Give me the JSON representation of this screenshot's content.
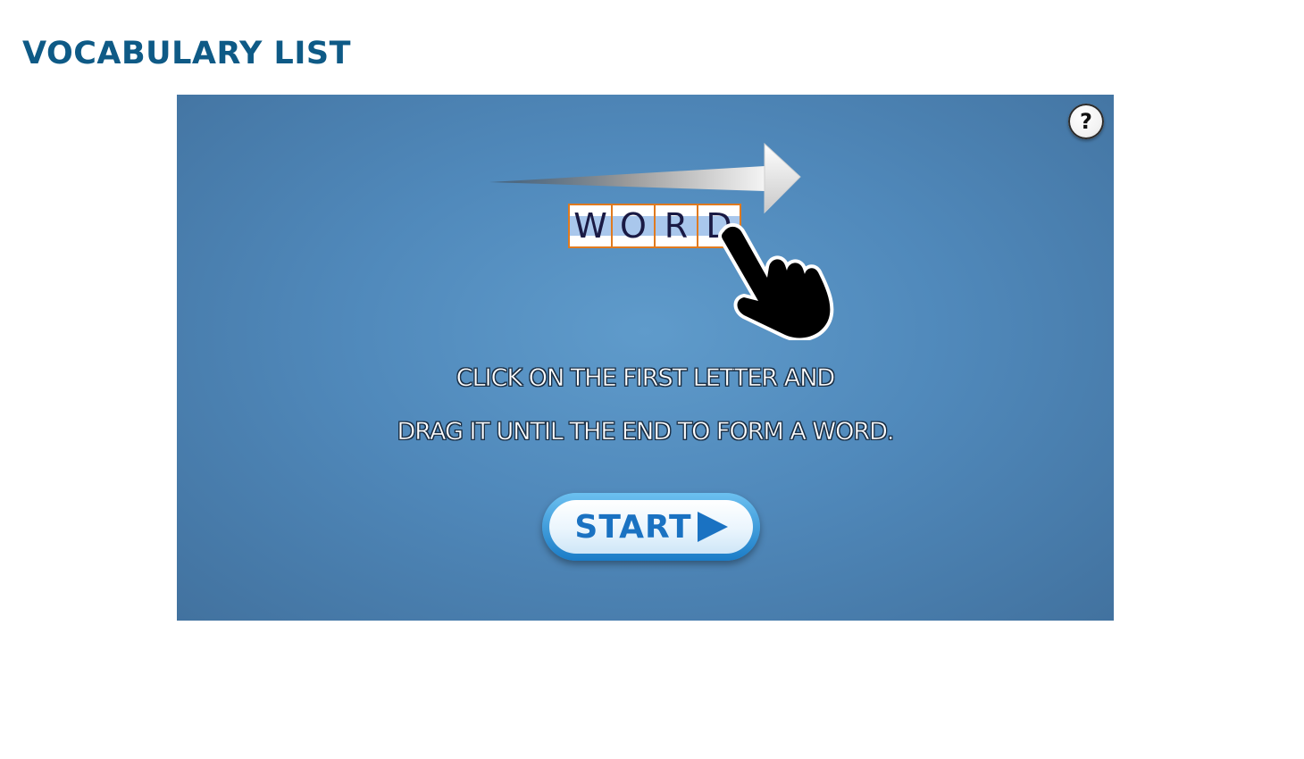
{
  "header": {
    "title": "VOCABULARY LIST"
  },
  "game": {
    "help_label": "?",
    "demo_letters": [
      "W",
      "O",
      "R",
      "D"
    ],
    "instructions": {
      "line1": "CLICK ON THE FIRST LETTER AND",
      "line2": "DRAG IT UNTIL THE END TO FORM A WORD."
    },
    "start_label": "START"
  },
  "colors": {
    "title": "#0e5a86",
    "stage_background": "#5089bb",
    "start_text": "#1a72c2",
    "letter_border": "#e07a1f",
    "selection_highlight": "#a9c7ec"
  }
}
